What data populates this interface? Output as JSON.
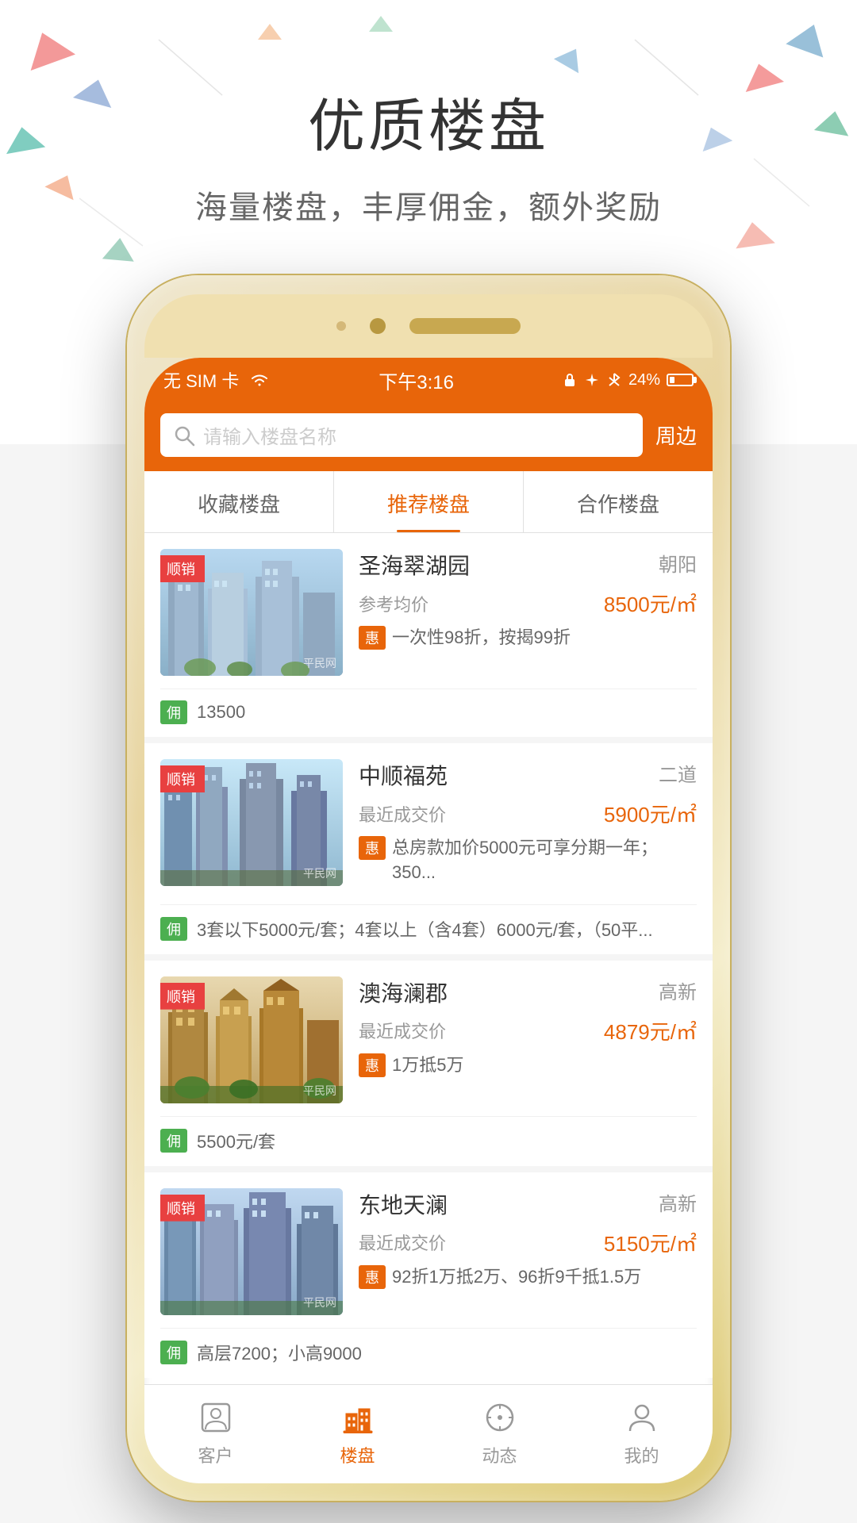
{
  "page": {
    "title": "优质楼盘",
    "subtitle": "海量楼盘，丰厚佣金，额外奖励"
  },
  "status_bar": {
    "carrier": "无 SIM 卡",
    "wifi": "WiFi",
    "time": "下午3:16",
    "battery": "24%"
  },
  "search": {
    "placeholder": "请输入楼盘名称",
    "nearby_label": "周边"
  },
  "tabs": [
    {
      "id": "saved",
      "label": "收藏楼盘",
      "active": false
    },
    {
      "id": "recommended",
      "label": "推荐楼盘",
      "active": true
    },
    {
      "id": "partner",
      "label": "合作楼盘",
      "active": false
    }
  ],
  "properties": [
    {
      "id": 1,
      "name": "圣海翠湖园",
      "district": "朝阳",
      "price_label": "参考均价",
      "price": "8500元/㎡",
      "promo": "一次性98折，按揭99折",
      "commission_label": "佣",
      "commission": "13500",
      "hot_badge": "顺销",
      "watermark": "平民网"
    },
    {
      "id": 2,
      "name": "中顺福苑",
      "district": "二道",
      "price_label": "最近成交价",
      "price": "5900元/㎡",
      "promo": "总房款加价5000元可享分期一年；350...",
      "commission_label": "佣",
      "commission": "3套以下5000元/套；4套以上（含4套）6000元/套，（50平...",
      "hot_badge": "顺销",
      "watermark": "平民网"
    },
    {
      "id": 3,
      "name": "澳海澜郡",
      "district": "高新",
      "price_label": "最近成交价",
      "price": "4879元/㎡",
      "promo": "1万抵5万",
      "commission_label": "佣",
      "commission": "5500元/套",
      "hot_badge": "顺销",
      "watermark": "平民网"
    },
    {
      "id": 4,
      "name": "东地天澜",
      "district": "高新",
      "price_label": "最近成交价",
      "price": "5150元/㎡",
      "promo": "92折1万抵2万、96折9千抵1.5万",
      "commission_label": "佣",
      "commission": "高层7200；小高9000",
      "hot_badge": "顺销",
      "watermark": "平民网"
    }
  ],
  "bottom_nav": [
    {
      "id": "client",
      "label": "客户",
      "active": false
    },
    {
      "id": "property",
      "label": "楼盘",
      "active": true
    },
    {
      "id": "news",
      "label": "动态",
      "active": false
    },
    {
      "id": "mine",
      "label": "我的",
      "active": false
    }
  ],
  "badges": {
    "hot": "顺销",
    "promo": "惠",
    "commission": "佣"
  }
}
